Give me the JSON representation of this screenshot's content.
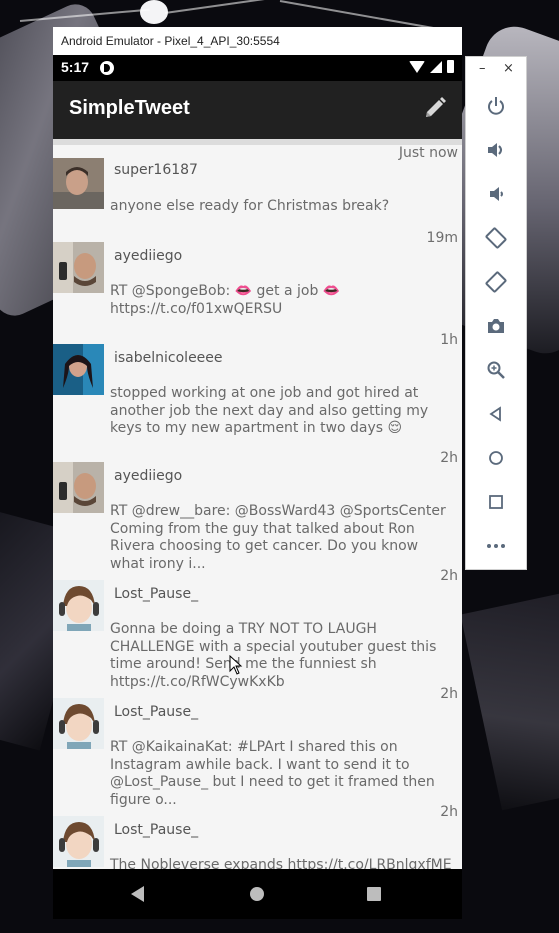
{
  "window": {
    "title": "Android Emulator - Pixel_4_API_30:5554",
    "minimize_glyph": "–",
    "close_glyph": "×"
  },
  "status_bar": {
    "time": "5:17",
    "icons": [
      "notification-app-icon",
      "wifi-icon",
      "signal-icon",
      "battery-icon"
    ]
  },
  "app_bar": {
    "title": "SimpleTweet",
    "action_icon": "compose-pencil-icon"
  },
  "tweets": [
    {
      "user": "super16187",
      "time": "Just now",
      "body": "anyone else ready for Christmas break?"
    },
    {
      "user": "ayediiego",
      "time": "19m",
      "body": "RT @SpongeBob: 👄 get a job 👄 https://t.co/f01xwQERSU"
    },
    {
      "user": "isabelnicoleeee",
      "time": "1h",
      "body": "stopped working at one job and got hired at another job the next day and also getting my keys to my new apartment in two days 😌"
    },
    {
      "user": "ayediiego",
      "time": "2h",
      "body": "RT @drew__bare: @BossWard43 @SportsCenter Coming from the guy that talked about Ron Rivera choosing to get cancer. Do you know what irony i..."
    },
    {
      "user": "Lost_Pause_",
      "time": "2h",
      "body": "Gonna be doing a TRY NOT TO LAUGH CHALLENGE with a special youtuber guest this time around! Send me the funniest sh https://t.co/RfWCywKxKb"
    },
    {
      "user": "Lost_Pause_",
      "time": "2h",
      "body": "RT @KaikainaKat: #LPArt I shared this on Instagram awhile back. I want to send it to @Lost_Pause_ but I need to get it framed then figure o..."
    },
    {
      "user": "Lost_Pause_",
      "time": "2h",
      "body": "The Nobleverse expands https://t.co/LRBnlqxfME"
    }
  ],
  "nav_bar": {
    "buttons": [
      "back-icon",
      "home-icon",
      "recents-icon"
    ]
  },
  "side_toolbar": {
    "buttons": [
      "power-icon",
      "volume-up-icon",
      "volume-down-icon",
      "rotate-left-icon",
      "rotate-right-icon",
      "camera-icon",
      "zoom-icon",
      "back-icon",
      "home-icon",
      "overview-icon",
      "more-icon"
    ]
  },
  "colors": {
    "app_bar": "#212121",
    "background": "#f5f5f5",
    "text": "#6a6a6a"
  }
}
